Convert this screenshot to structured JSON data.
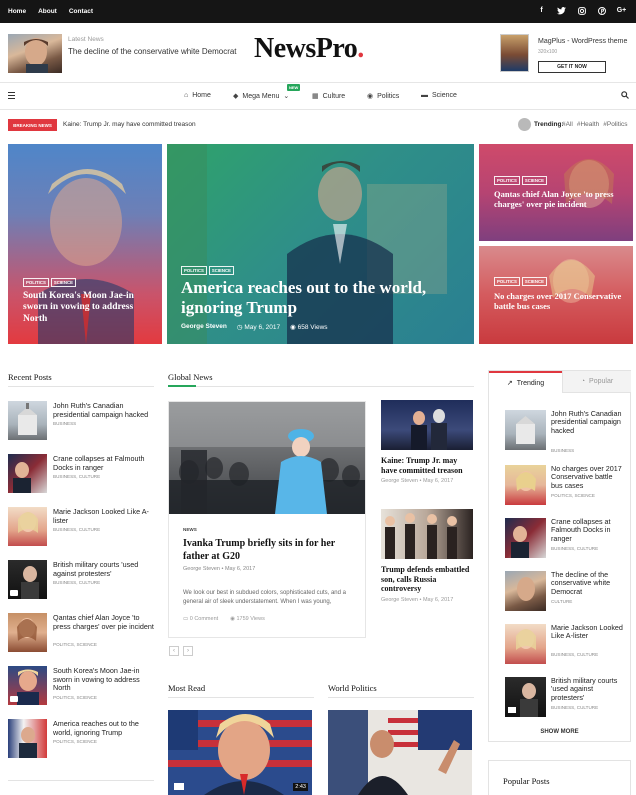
{
  "topbar": {
    "links": [
      "Home",
      "About",
      "Contact"
    ],
    "social": [
      "facebook-icon",
      "twitter-icon",
      "instagram-icon",
      "pinterest-icon",
      "googleplus-icon"
    ]
  },
  "header": {
    "latest_label": "Latest News",
    "latest_headline": "The decline of the conservative white Democrat",
    "logo": "NewsPro",
    "logo_dot": ".",
    "ad_title": "MagPlus - WordPress theme",
    "ad_sub": "320x100",
    "ad_button": "GET IT NOW"
  },
  "nav": {
    "items": [
      "Home",
      "Mega Menu",
      "Culture",
      "Politics",
      "Science"
    ],
    "new_badge": "NEW"
  },
  "breaking": {
    "label": "BREAKING NEWS",
    "text": "Kaine: Trump Jr. may have committed treason",
    "trending_label": "Trending:",
    "tags": [
      "#All",
      "#Health",
      "#Politics"
    ]
  },
  "hero": {
    "left": {
      "tags": [
        "POLITICS",
        "SCIENCE"
      ],
      "title": "South Korea's Moon Jae-in sworn in vowing to address North"
    },
    "main": {
      "tags": [
        "POLITICS",
        "SCIENCE"
      ],
      "title": "America reaches out to the world, ignoring Trump",
      "author": "George Steven",
      "date": "May 6, 2017",
      "views": "658 Views"
    },
    "right_top": {
      "tags": [
        "POLITICS",
        "SCIENCE"
      ],
      "title": "Qantas chief Alan Joyce 'to press charges' over pie incident"
    },
    "right_bottom": {
      "tags": [
        "POLITICS",
        "SCIENCE"
      ],
      "title": "No charges over 2017 Conservative battle bus cases"
    }
  },
  "recent": {
    "title": "Recent Posts",
    "items": [
      {
        "title": "John Ruth's Canadian presidential campaign hacked",
        "cat": "BUSINESS"
      },
      {
        "title": "Crane collapses at Falmouth Docks in ranger",
        "cat": "BUSINESS, CULTURE"
      },
      {
        "title": "Marie Jackson Looked Like A-lister",
        "cat": "BUSINESS, CULTURE"
      },
      {
        "title": "British military courts 'used against protesters'",
        "cat": "BUSINESS, CULTURE"
      },
      {
        "title": "Qantas chief Alan Joyce 'to press charges' over pie incident",
        "cat": "POLITICS, SCIENCE"
      },
      {
        "title": "South Korea's Moon Jae-in sworn in vowing to address North",
        "cat": "POLITICS, SCIENCE"
      },
      {
        "title": "America reaches out to the world, ignoring Trump",
        "cat": "POLITICS, SCIENCE"
      }
    ]
  },
  "global": {
    "title": "Global News",
    "main": {
      "cat": "NEWS",
      "title": "Ivanka Trump briefly sits in for her father at G20",
      "meta": "George Steven • May 6, 2017",
      "desc": "We look our best in subdued colors, sophisticated cuts, and a general air of sleek understatement. When I was young,",
      "comments": "0 Comment",
      "views": "1759 Views"
    },
    "side": [
      {
        "title": "Kaine: Trump Jr. may have committed treason",
        "meta": "George Steven • May 6, 2017"
      },
      {
        "title": "Trump defends embattled son, calls Russia controversy",
        "meta": "George Steven • May 6, 2017"
      }
    ],
    "pager": [
      "‹",
      "›"
    ]
  },
  "most_read": {
    "title": "Most Read",
    "duration": "2:43"
  },
  "world_politics": {
    "title": "World Politics"
  },
  "sidebar": {
    "tab_trending": "Trending",
    "tab_popular": "Popular",
    "items": [
      {
        "title": "John Ruth's Canadian presidential campaign hacked",
        "cat": "BUSINESS"
      },
      {
        "title": "No charges over 2017 Conservative battle bus cases",
        "cat": "POLITICS, SCIENCE"
      },
      {
        "title": "Crane collapses at Falmouth Docks in ranger",
        "cat": "BUSINESS, CULTURE"
      },
      {
        "title": "The decline of the conservative white Democrat",
        "cat": "CULTURE"
      },
      {
        "title": "Marie Jackson Looked Like A-lister",
        "cat": "BUSINESS, CULTURE"
      },
      {
        "title": "British military courts 'used against protesters'",
        "cat": "BUSINESS, CULTURE"
      }
    ],
    "show_more": "SHOW MORE",
    "popular_posts": "Popular Posts"
  },
  "colors": {
    "accent": "#e0373f",
    "dark": "#151515",
    "new_badge": "#26a65b"
  }
}
